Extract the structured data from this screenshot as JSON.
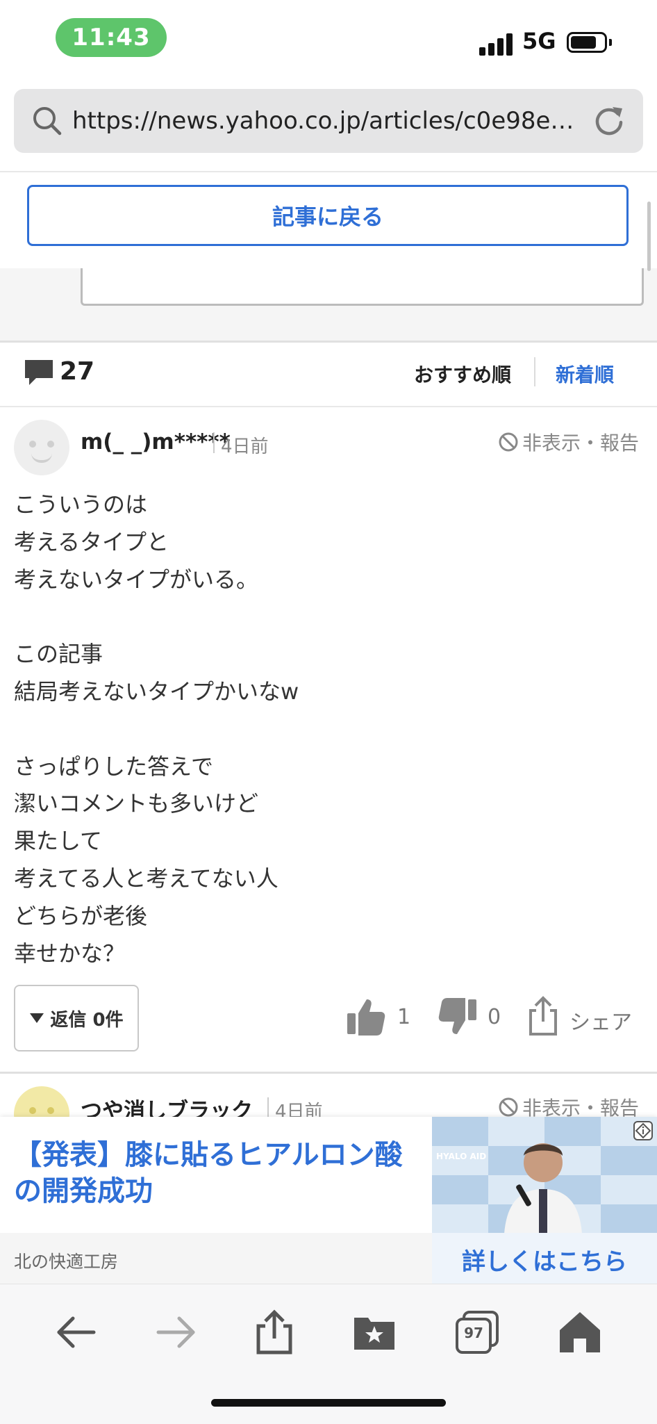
{
  "status_bar": {
    "time": "11:43",
    "network": "5G"
  },
  "browser": {
    "url": "https://news.yahoo.co.jp/articles/c0e98e3…",
    "tabs_count": "97"
  },
  "article_nav": {
    "back_button": "記事に戻る"
  },
  "comments_header": {
    "count": "27",
    "sort_recommended": "おすすめ順",
    "sort_newest": "新着順"
  },
  "comment": {
    "username": "m(_ _)m*****",
    "time_ago": "4日前",
    "report_label": "非表示・報告",
    "body_lines": [
      "こういうのは",
      "考えるタイプと",
      "考えないタイプがいる。",
      "",
      "この記事",
      "結局考えないタイプかいなw",
      "",
      "さっぱりした答えで",
      "潔いコメントも多いけど",
      "果たして",
      "考えてる人と考えてない人",
      "どちらが老後",
      "幸せかな？"
    ],
    "reply_button": "返信 0件",
    "likes": "1",
    "dislikes": "0",
    "share_label": "シェア"
  },
  "next_comment": {
    "username": "つや消しブラック",
    "time_ago": "4日前",
    "report_label": "非表示・報告"
  },
  "ad": {
    "title": "【発表】膝に貼るヒアルロン酸の開発成功",
    "sponsor": "北の快適工房",
    "cta": "詳しくはこちら",
    "image_text": "HYALO AID"
  },
  "colors": {
    "accent": "#2f6fd6",
    "time_pill": "#5ec56b"
  }
}
